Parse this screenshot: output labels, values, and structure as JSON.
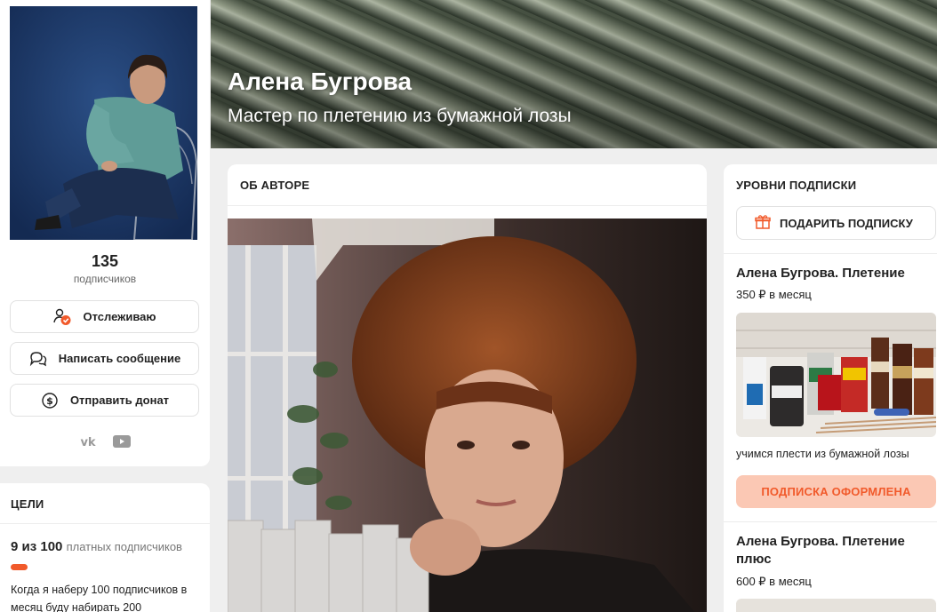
{
  "profile": {
    "subscriber_count": "135",
    "subscriber_label": "подписчиков",
    "follow_label": "Отслеживаю",
    "message_label": "Написать сообщение",
    "donate_label": "Отправить донат",
    "socials": [
      "vk-icon",
      "youtube-icon"
    ]
  },
  "goals": {
    "title": "ЦЕЛИ",
    "progress_count": "9 из 100",
    "progress_unit": "платных подписчиков",
    "progress_fraction": 0.09,
    "description": "Когда я наберу 100 подписчиков в месяц буду набирать 200"
  },
  "banner": {
    "name": "Алена Бугрова",
    "tagline": "Мастер по плетению из бумажной лозы"
  },
  "about": {
    "title": "ОБ АВТОРЕ"
  },
  "tiers": {
    "title": "УРОВНИ ПОДПИСКИ",
    "gift_label": "ПОДАРИТЬ ПОДПИСКУ",
    "items": [
      {
        "name": "Алена Бугрова. Плетение",
        "price": "350 ₽ в месяц",
        "description": "учимся плести из бумажной лозы",
        "button_label": "ПОДПИСКА ОФОРМЛЕНА"
      },
      {
        "name": "Алена Бугрова. Плетение плюс",
        "price": "600 ₽ в месяц"
      }
    ]
  },
  "colors": {
    "accent": "#f15a2b",
    "accent_soft": "#fbc8b4",
    "background": "#efefef"
  }
}
